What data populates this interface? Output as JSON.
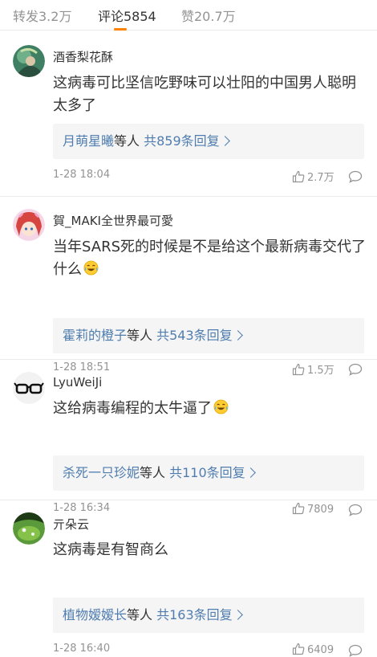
{
  "tabs": [
    {
      "label": "转发3.2万"
    },
    {
      "label": "评论5854"
    },
    {
      "label": "赞20.7万"
    }
  ],
  "colors": {
    "accent": "#ff8200",
    "link": "#507daf",
    "muted": "#939393"
  },
  "comments": [
    {
      "username": "酒香梨花酥",
      "text": "这病毒可比坚信吃野味可以壮阳的中国男人聪明太多了",
      "reply_user": "月萌星曦",
      "reply_mid": "等人 ",
      "reply_count": "共859条回复",
      "time": "1-28 18:04",
      "likes": "2.7万",
      "avatar_icon": "avatar-green-portrait"
    },
    {
      "username": "賀_MAKI全世界最可愛",
      "text": "当年SARS死的时候是不是给这个最新病毒交代了什么",
      "emoji": "laugh-cry-emoji",
      "reply_user": "霍莉的橙子",
      "reply_mid": "等人 ",
      "reply_count": "共543条回复",
      "time": "1-28 18:51",
      "likes": "1.5万",
      "avatar_icon": "avatar-anime-girl"
    },
    {
      "username": "LyuWeiJi",
      "text": "这给病毒编程的太牛逼了",
      "emoji": "laugh-cry-emoji",
      "reply_user": "杀死一只珍妮",
      "reply_mid": "等人 ",
      "reply_count": "共110条回复",
      "time": "1-28 16:34",
      "likes": "7809",
      "avatar_icon": "avatar-glasses"
    },
    {
      "username": "亓朵云",
      "text": "这病毒是有智商么",
      "reply_user": "植物嫒嫒长",
      "reply_mid": "等人 ",
      "reply_count": "共163条回复",
      "time": "1-28 16:40",
      "likes": "6409",
      "avatar_icon": "avatar-green-field"
    }
  ]
}
